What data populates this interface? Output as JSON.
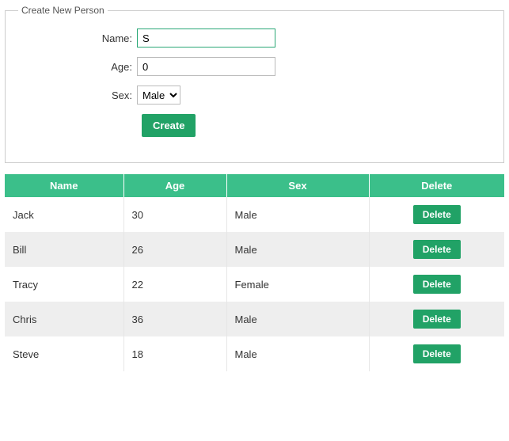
{
  "form": {
    "legend": "Create New Person",
    "name_label": "Name:",
    "name_value": "S",
    "age_label": "Age:",
    "age_value": "0",
    "sex_label": "Sex:",
    "sex_value": "Male",
    "create_label": "Create"
  },
  "table": {
    "headers": {
      "name": "Name",
      "age": "Age",
      "sex": "Sex",
      "delete": "Delete"
    },
    "delete_label": "Delete",
    "rows": [
      {
        "name": "Jack",
        "age": "30",
        "sex": "Male"
      },
      {
        "name": "Bill",
        "age": "26",
        "sex": "Male"
      },
      {
        "name": "Tracy",
        "age": "22",
        "sex": "Female"
      },
      {
        "name": "Chris",
        "age": "36",
        "sex": "Male"
      },
      {
        "name": "Steve",
        "age": "18",
        "sex": "Male"
      }
    ]
  },
  "colors": {
    "accent": "#21a266",
    "header": "#3bbf8a"
  }
}
